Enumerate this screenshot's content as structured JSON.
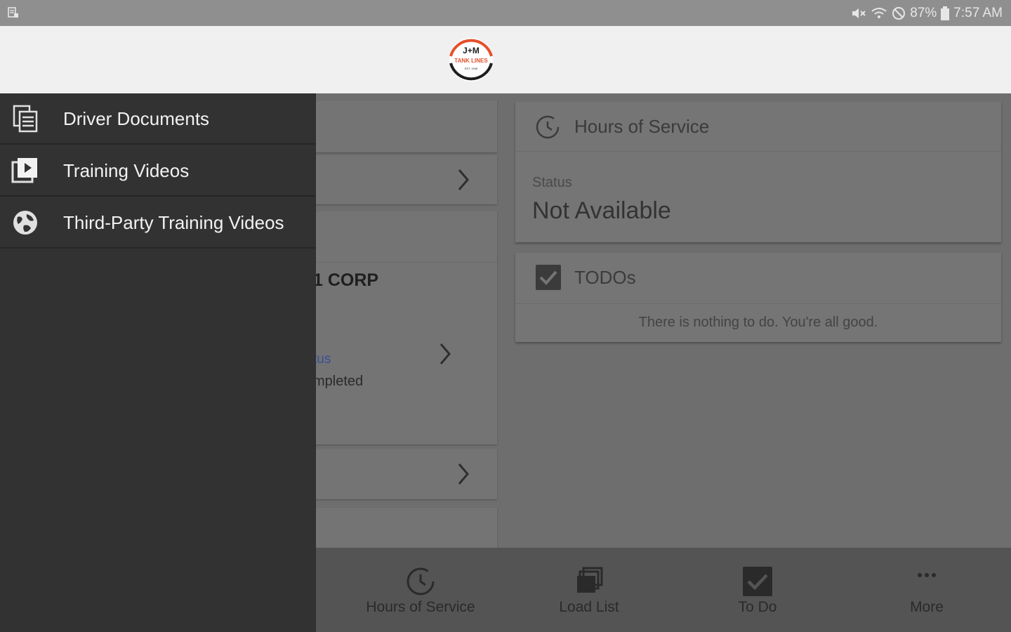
{
  "status_bar": {
    "battery": "87%",
    "time": "7:57 AM"
  },
  "app": {
    "logo_icon": "jm-tank-lines-logo",
    "logo_text_top": "J+M",
    "logo_text_middle": "TANK LINES",
    "logo_text_bottom": "EST. 1946"
  },
  "drawer": {
    "items": [
      {
        "label": "Driver Documents",
        "icon": "documents-icon"
      },
      {
        "label": "Training Videos",
        "icon": "play-video-icon"
      },
      {
        "label": "Third-Party Training Videos",
        "icon": "globe-icon"
      }
    ]
  },
  "load_card": {
    "company": "1 CORP",
    "status_label": "tus",
    "status_value": "mpleted"
  },
  "hours_of_service": {
    "title": "Hours of Service",
    "status_label": "Status",
    "status_value": "Not Available"
  },
  "todos": {
    "title": "TODOs",
    "empty_message": "There is nothing to do. You're all good."
  },
  "bottom_nav": {
    "items": [
      {
        "label": "Hours of Service",
        "icon": "clock-icon"
      },
      {
        "label": "Load List",
        "icon": "load-list-icon"
      },
      {
        "label": "To Do",
        "icon": "checkbox-icon"
      },
      {
        "label": "More",
        "icon": "more-dots-icon"
      }
    ]
  },
  "colors": {
    "drawer_bg": "#323232",
    "scrim_content": "#6e6e6e",
    "logo_accent": "#e5502b"
  }
}
